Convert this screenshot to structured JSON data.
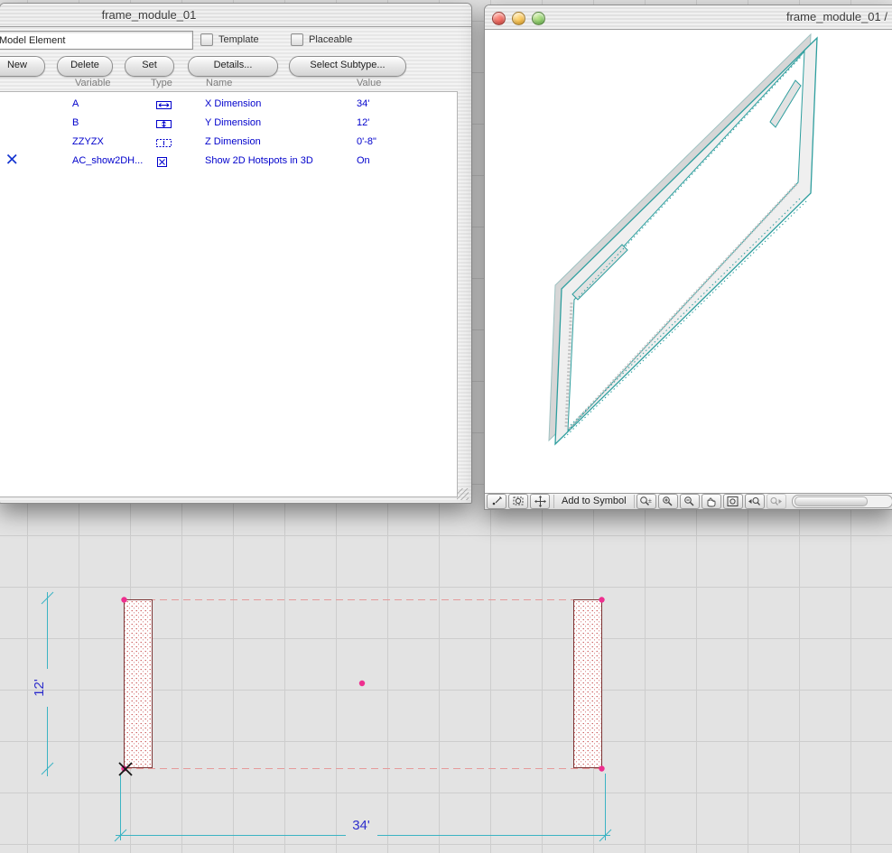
{
  "param_window": {
    "title": "frame_module_01",
    "subtype_field": {
      "value": "Model Element"
    },
    "template_checkbox": {
      "label": "Template",
      "checked": false
    },
    "placeable_checkbox": {
      "label": "Placeable",
      "checked": false
    },
    "buttons": {
      "new": "New",
      "delete": "Delete",
      "set": "Set",
      "details": "Details...",
      "select_subtype": "Select Subtype..."
    },
    "columns": {
      "variable": "Variable",
      "type": "Type",
      "name": "Name",
      "value": "Value"
    },
    "rows": [
      {
        "variable": "A",
        "type_icon": "x-dimension-type-icon",
        "name": "X Dimension",
        "value": "34'"
      },
      {
        "variable": "B",
        "type_icon": "y-dimension-type-icon",
        "name": "Y Dimension",
        "value": "12'"
      },
      {
        "variable": "ZZYZX",
        "type_icon": "z-dimension-type-icon",
        "name": "Z Dimension",
        "value": "0'-8\""
      },
      {
        "variable": "AC_show2DH...",
        "type_icon": "boolean-type-icon",
        "name": "Show 2D Hotspots in 3D",
        "value": "On"
      }
    ]
  },
  "view_window": {
    "title": "frame_module_01 /",
    "toolbar": {
      "add_to_symbol": "Add to Symbol"
    }
  },
  "plan": {
    "vertical_dimension": "12'",
    "horizontal_dimension": "34'"
  },
  "colors": {
    "parameter_text": "#0000cc",
    "dimension_text": "#2d2dcc",
    "dimension_line": "#3bb3c3",
    "hotspot": "#ee2f8f",
    "frame_outline": "#2e9e9e",
    "stipple_fill": "#c23b3b"
  }
}
